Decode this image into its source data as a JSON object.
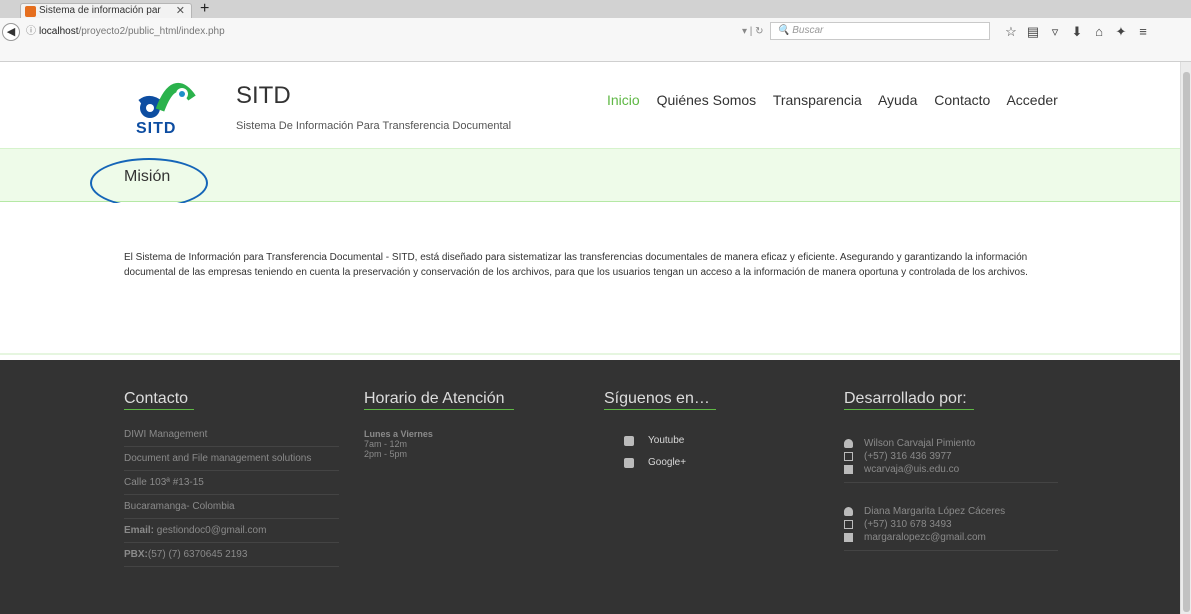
{
  "browser": {
    "tab_title": "Sistema de información par",
    "url_host": "localhost",
    "url_path": "/proyecto2/public_html/index.php",
    "search_placeholder": "Buscar"
  },
  "header": {
    "logo_text": "SITD",
    "title": "SITD",
    "subtitle": "Sistema De Información Para Transferencia Documental",
    "menu": [
      "Inicio",
      "Quiénes Somos",
      "Transparencia",
      "Ayuda",
      "Contacto",
      "Acceder"
    ]
  },
  "section": {
    "title": "Misión",
    "text": "El Sistema de Información para Transferencia Documental - SITD, está diseñado para sistematizar las transferencias documentales de manera eficaz y eficiente. Asegurando y garantizando la información documental de las empresas teniendo en cuenta la preservación y conservación de los archivos, para que los usuarios tengan un acceso a la información de manera oportuna y controlada de los archivos."
  },
  "footer": {
    "contacto": {
      "title": "Contacto",
      "lines": [
        "DIWI Management",
        "Document and File management solutions",
        "Calle 103ª #13-15",
        "Bucaramanga- Colombia"
      ],
      "email_label": "Email:",
      "email": "gestiondoc0@gmail.com",
      "pbx_label": "PBX:",
      "pbx": "(57) (7) 6370645 2193"
    },
    "horario": {
      "title": "Horario de Atención",
      "days": "Lunes a Viernes",
      "slot1": "7am - 12m",
      "slot2": "2pm - 5pm"
    },
    "siguenos": {
      "title": "Síguenos en…",
      "items": [
        "Youtube",
        "Google+"
      ]
    },
    "desarrollado": {
      "title": "Desarrollado por:",
      "people": [
        {
          "name": "Wilson Carvajal Pimiento",
          "phone": "(+57) 316 436 3977",
          "email": "wcarvaja@uis.edu.co"
        },
        {
          "name": "Diana Margarita López Cáceres",
          "phone": "(+57) 310 678 3493",
          "email": "margaralopezc@gmail.com"
        }
      ]
    }
  }
}
